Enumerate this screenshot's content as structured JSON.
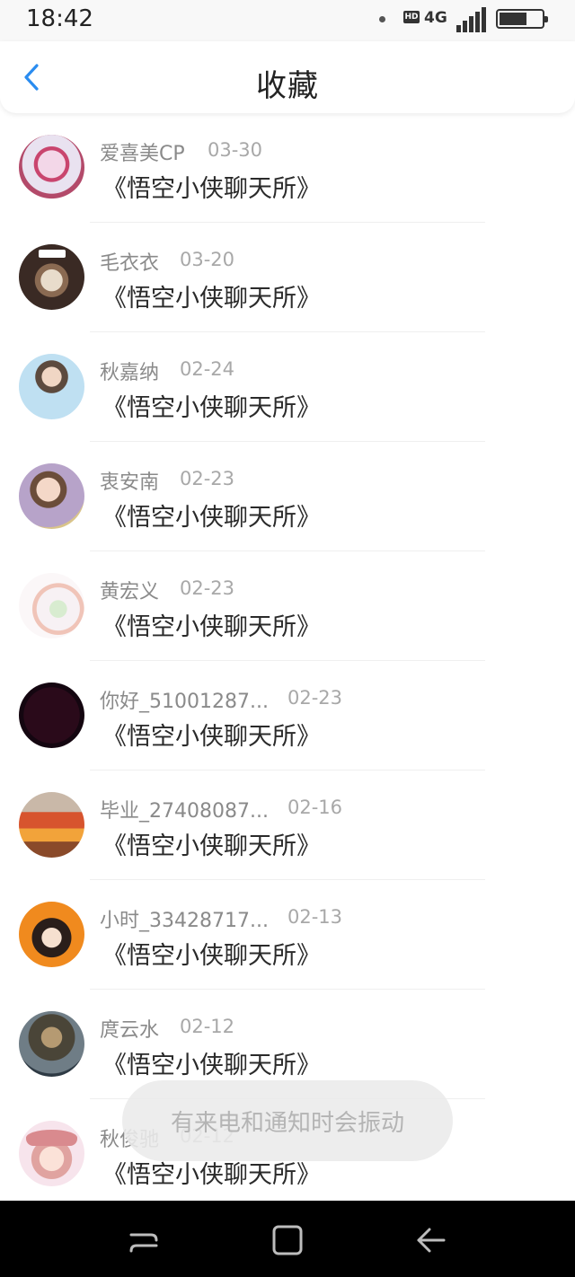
{
  "status_bar": {
    "time": "18:42",
    "hd": "HD",
    "network": "4G",
    "battery_level": 0.65
  },
  "header": {
    "title": "收藏",
    "back_icon": "chevron-left-icon"
  },
  "favorites": [
    {
      "name": "爱喜美CP",
      "date": "03-30",
      "title": "《悟空小侠聊天所》"
    },
    {
      "name": "毛衣衣",
      "date": "03-20",
      "title": "《悟空小侠聊天所》"
    },
    {
      "name": "秋嘉纳",
      "date": "02-24",
      "title": "《悟空小侠聊天所》"
    },
    {
      "name": "衷安南",
      "date": "02-23",
      "title": "《悟空小侠聊天所》"
    },
    {
      "name": "黄宏义",
      "date": "02-23",
      "title": "《悟空小侠聊天所》"
    },
    {
      "name": "你好_51001287...",
      "date": "02-23",
      "title": "《悟空小侠聊天所》"
    },
    {
      "name": "毕业_27408087...",
      "date": "02-16",
      "title": "《悟空小侠聊天所》"
    },
    {
      "name": "小时_33428717...",
      "date": "02-13",
      "title": "《悟空小侠聊天所》"
    },
    {
      "name": "庹云水",
      "date": "02-12",
      "title": "《悟空小侠聊天所》"
    },
    {
      "name": "秋俊驰",
      "date": "02-12",
      "title": "《悟空小侠聊天所》"
    }
  ],
  "toast": {
    "text": "有来电和通知时会振动"
  },
  "nav_bar": {
    "icons": [
      "recent-apps-icon",
      "home-icon",
      "back-icon"
    ]
  },
  "colors": {
    "accent": "#2a8cf0",
    "name_text": "#8a8a8a",
    "date_text": "#a8a8a8",
    "title_text": "#2a2a2a"
  }
}
